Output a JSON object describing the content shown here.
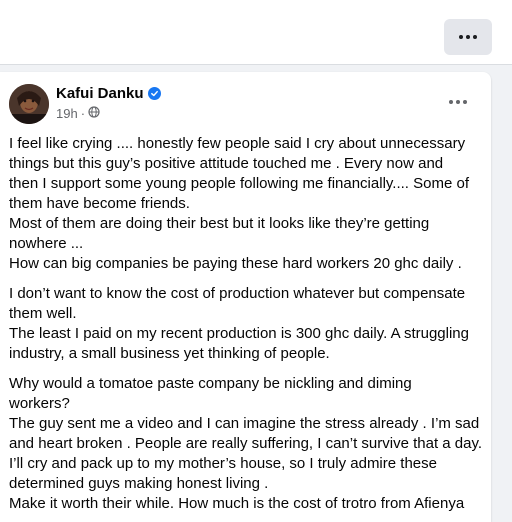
{
  "post": {
    "author": "Kafui Danku",
    "time": "19h",
    "paragraphs": [
      {
        "lines": [
          "I feel like crying .... honestly few people said I cry about unnecessary",
          "things but this guy’s positive attitude touched me . Every now and",
          "then I support some young people following me financially.... Some of",
          "them have become friends.",
          "Most of them are doing their best but it looks like they’re getting",
          "nowhere ...",
          "How can big companies be paying these hard workers 20 ghc daily ."
        ]
      },
      {
        "lines": [
          "I don’t want to know the cost of production whatever but compensate",
          "them well.",
          "The least I paid on my recent production is 300 ghc daily. A struggling",
          "industry, a small business yet thinking of people."
        ]
      },
      {
        "lines": [
          "Why would a tomatoe paste company be nickling and diming",
          "workers?",
          "The guy sent me a video and I can imagine the stress already . I’m sad",
          "and heart broken . People are really suffering, I can’t survive that a day.",
          "I’ll cry and pack up to my mother’s house, so I truly admire these",
          "determined guys making honest living .",
          "Make it worth their while. How much is the cost of trotro from Afienya"
        ]
      }
    ]
  },
  "icons": {
    "top_more": "more-horizontal-icon",
    "post_more": "more-horizontal-icon",
    "verified": "verified-badge-icon",
    "audience": "globe-icon"
  },
  "colors": {
    "background": "#f0f2f5",
    "card": "#ffffff",
    "text": "#050505",
    "secondary_text": "#65676b",
    "verified_blue": "#1877f2"
  }
}
